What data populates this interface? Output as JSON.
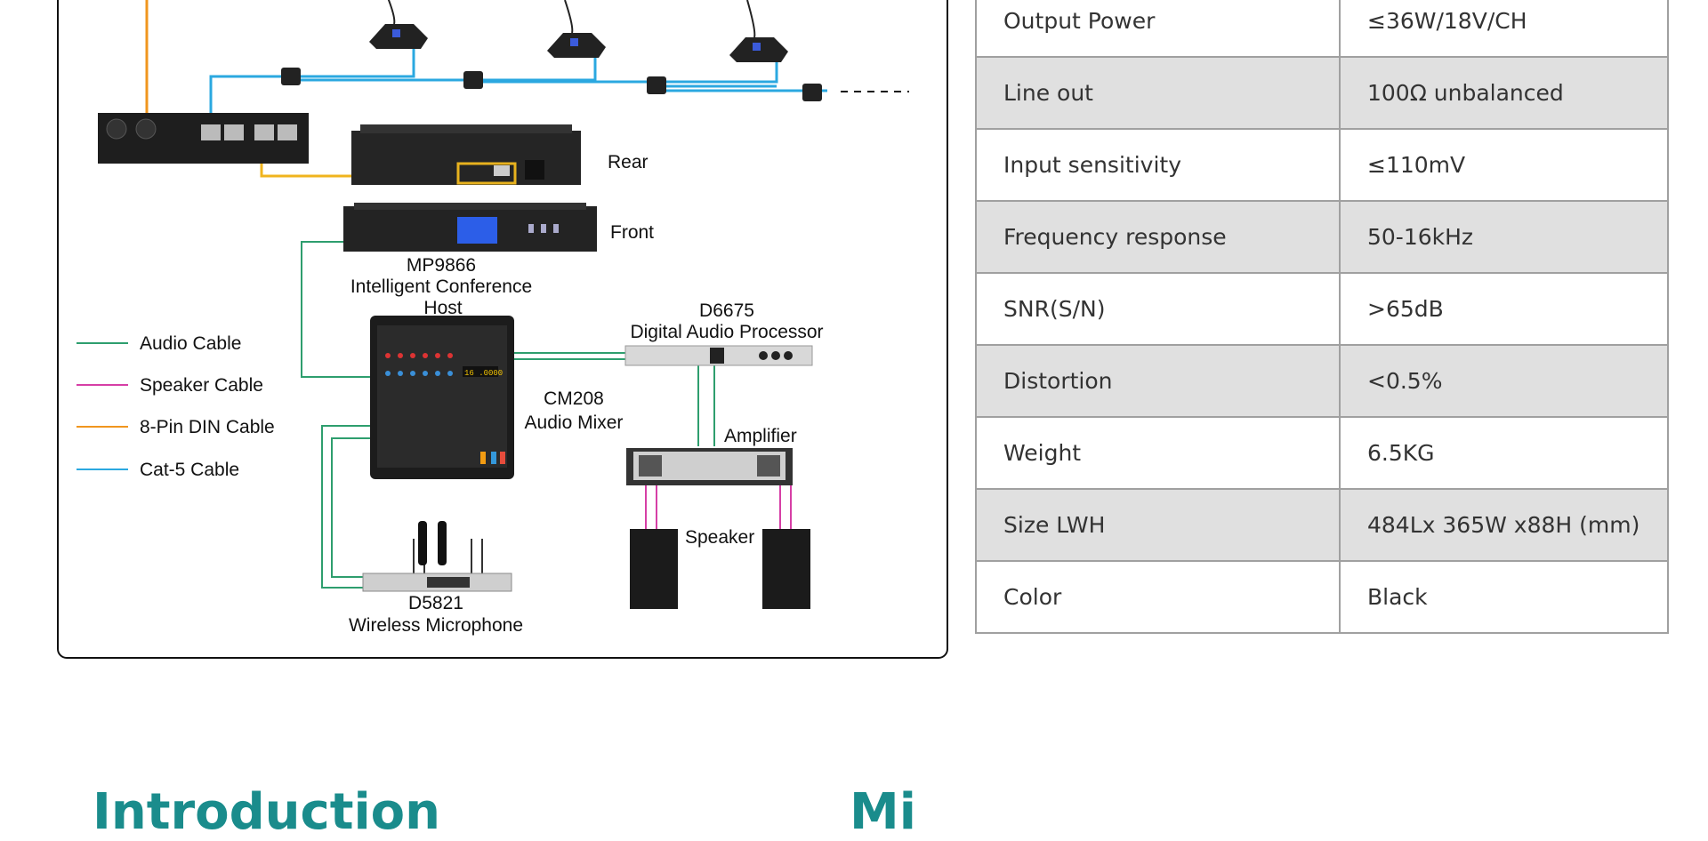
{
  "diagram": {
    "labels": {
      "rear": "Rear",
      "front": "Front",
      "host_model": "MP9866",
      "host_name_1": "Intelligent Conference",
      "host_name_2": "Host",
      "mixer_model": "CM208",
      "mixer_name": "Audio Mixer",
      "processor_model": "D6675",
      "processor_name": "Digital Audio Processor",
      "amplifier": "Amplifier",
      "speaker": "Speaker",
      "mic_model": "D5821",
      "mic_name": "Wireless Microphone"
    },
    "legend": [
      {
        "label": "Audio Cable",
        "color": "#2e9e6e"
      },
      {
        "label": "Speaker Cable",
        "color": "#d63fa6"
      },
      {
        "label": "8-Pin DIN Cable",
        "color": "#f0961e"
      },
      {
        "label": "Cat-5 Cable",
        "color": "#2ba8e0"
      }
    ]
  },
  "specs": [
    {
      "name": "Output Power",
      "value": "≤36W/18V/CH",
      "shaded": false
    },
    {
      "name": "Line out",
      "value": "100Ω unbalanced",
      "shaded": true
    },
    {
      "name": "Input sensitivity",
      "value": "≤110mV",
      "shaded": false
    },
    {
      "name": "Frequency response",
      "value": "50-16kHz",
      "shaded": true
    },
    {
      "name": "SNR(S/N)",
      "value": ">65dB",
      "shaded": false
    },
    {
      "name": "Distortion",
      "value": "<0.5%",
      "shaded": true
    },
    {
      "name": "Weight",
      "value": "6.5KG",
      "shaded": false
    },
    {
      "name": "Size  LWH",
      "value": "484Lx 365W x88H (mm)",
      "shaded": true
    },
    {
      "name": "Color",
      "value": "Black",
      "shaded": false
    }
  ],
  "sections": {
    "left_heading": "Introduction",
    "right_heading": "Mi"
  },
  "colors": {
    "accent": "#1a8c8c",
    "row_shade": "#e0e0e0"
  }
}
